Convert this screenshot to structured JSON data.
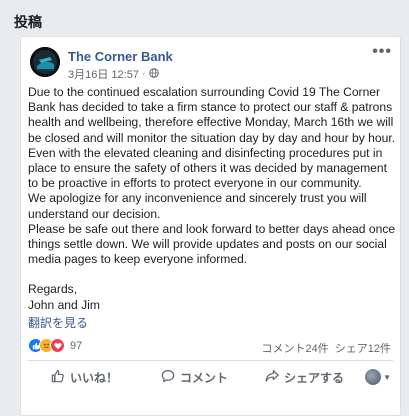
{
  "section": {
    "title": "投稿"
  },
  "post": {
    "page_name": "The Corner Bank",
    "timestamp": "3月16日 12:57",
    "privacy_separator": "·",
    "more_label": "•••",
    "paragraphs": [
      "Due to the continued escalation surrounding Covid 19 The Corner Bank has decided to take a firm stance to protect our staff & patrons health and wellbeing, therefore effective Monday, March 16th we will be closed and will monitor the situation day by day and hour by hour.",
      "Even with the elevated cleaning and disinfecting procedures put in place to ensure the safety of others it was decided by management to be proactive in efforts to protect everyone in our community.",
      "We apologize for any inconvenience and sincerely trust you will understand our decision.",
      "Please be safe out there and look forward to better days ahead once things settle down. We will provide updates and posts on our social media pages to keep everyone informed."
    ],
    "closing": [
      "Regards,",
      "John and Jim"
    ],
    "translate_link": "翻訳を見る",
    "reaction_count": "97",
    "comments_count": "コメント24件",
    "shares_count": "シェア12件",
    "actions": {
      "like": "いいね！",
      "comment": "コメント",
      "share": "シェアする"
    },
    "colors": {
      "link": "#385898",
      "like_blue": "#1877f2",
      "love_red": "#f33e58",
      "sad_yellow": "#f7b125"
    }
  }
}
